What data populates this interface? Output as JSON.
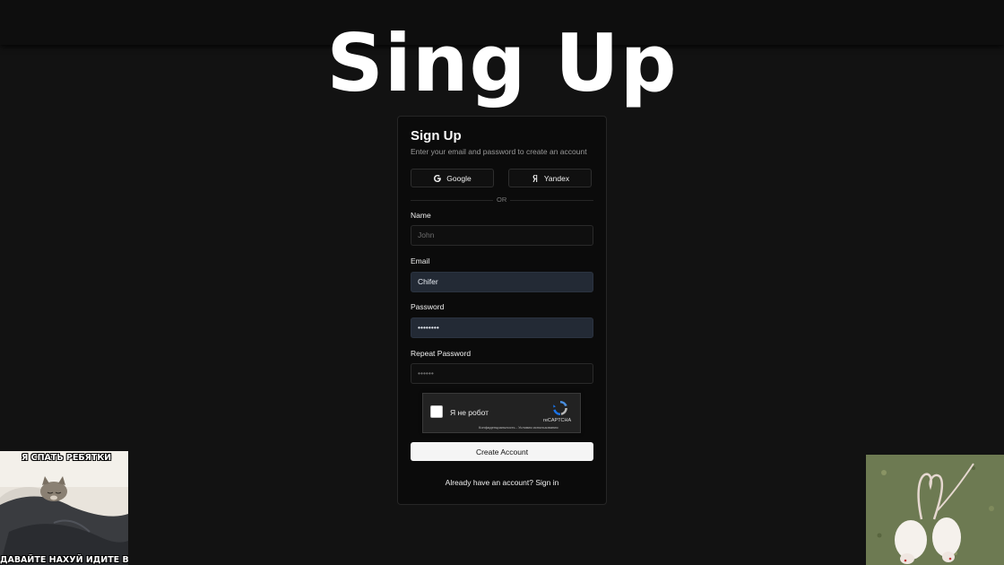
{
  "page": {
    "big_title": "Sing Up"
  },
  "form": {
    "title": "Sign Up",
    "subtitle": "Enter your email and password to create an account",
    "google_label": "Google",
    "yandex_label": "Yandex",
    "divider_label": "OR",
    "name": {
      "label": "Name",
      "placeholder": "John"
    },
    "email": {
      "label": "Email",
      "value": "Chifer"
    },
    "password": {
      "label": "Password",
      "value": "••••••••"
    },
    "repeat_password": {
      "label": "Repeat Password",
      "value": "••••••"
    },
    "create_button": "Create Account",
    "signin_text": "Already have an account? Sign in"
  },
  "captcha": {
    "label": "Я не робот",
    "brand": "reCAPTCHA",
    "links": "Конфиденциальность - Условия использования"
  },
  "memes": {
    "left_top_caption": "Я СПАТЬ РЕБЯТКИ",
    "left_bottom_caption": "ДАВАЙТЕ НАХУЙ ИДИТЕ ВСЕ"
  },
  "icons": {
    "google": "google-icon",
    "yandex": "yandex-icon",
    "recaptcha": "recaptcha-logo-icon"
  },
  "colors": {
    "background": "#121212",
    "card": "#0b0b0b",
    "filled_input": "#232a35",
    "primary_button": "#f5f5f5"
  }
}
